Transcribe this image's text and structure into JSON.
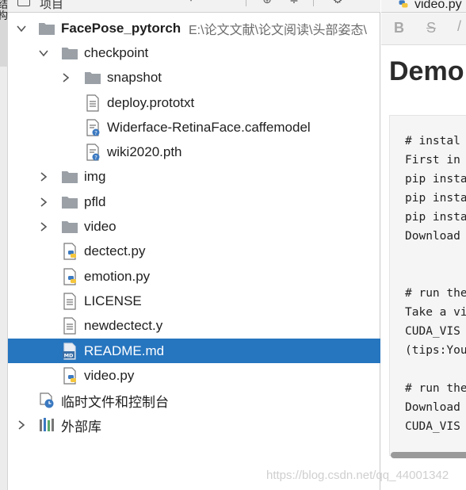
{
  "left_stripe": {
    "label": "结构"
  },
  "panel_header": {
    "title": "项目"
  },
  "tree": {
    "project_name": "FacePose_pytorch",
    "project_path": "E:\\论文文献\\论文阅读\\头部姿态\\",
    "items": [
      {
        "label": "checkpoint"
      },
      {
        "label": "snapshot"
      },
      {
        "label": "deploy.prototxt"
      },
      {
        "label": "Widerface-RetinaFace.caffemodel"
      },
      {
        "label": "wiki2020.pth"
      },
      {
        "label": "img"
      },
      {
        "label": "pfld"
      },
      {
        "label": "video"
      },
      {
        "label": "dectect.py"
      },
      {
        "label": "emotion.py"
      },
      {
        "label": "LICENSE"
      },
      {
        "label": "newdectect.y"
      },
      {
        "label": "README.md"
      },
      {
        "label": "video.py"
      },
      {
        "label": "临时文件和控制台"
      },
      {
        "label": "外部库"
      }
    ]
  },
  "editor": {
    "tab_label": "video.py",
    "toolbar": {
      "bold": "B",
      "strike": "S"
    },
    "heading": "Demo",
    "code_lines": [
      "# instal",
      "First in",
      "pip insta",
      "pip insta",
      "pip insta",
      "Download",
      "",
      "",
      "# run the",
      "Take a vi",
      "CUDA_VIS",
      "(tips:You",
      "",
      "# run the",
      "Download",
      "CUDA_VIS"
    ]
  },
  "watermark": "https://blog.csdn.net/qq_44001342",
  "colors": {
    "selection": "#2675bf",
    "folder": "#9aa0a6",
    "python_blue": "#3b79c1",
    "python_yellow": "#f4c63d"
  }
}
